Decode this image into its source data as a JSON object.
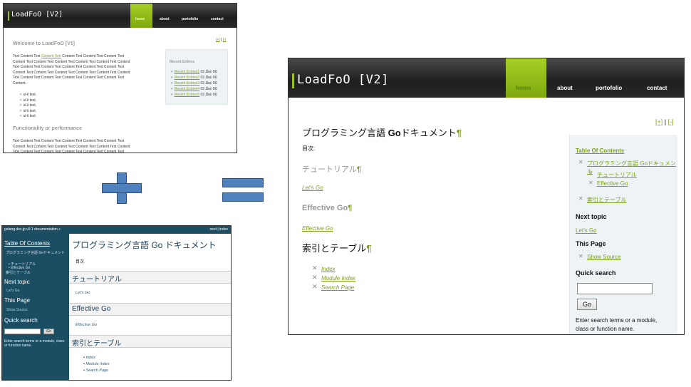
{
  "shotA": {
    "title": "LoadFoO [V2]",
    "nav": [
      "home",
      "about",
      "portofolio",
      "contact"
    ],
    "toggle_plus": "[+]",
    "toggle_sep": "|",
    "toggle_minus": "[-]",
    "welcome": "Welcome to LoadFoO [V1]",
    "para_lines": [
      [
        "Text Content Text ",
        "Content Text",
        " Content Text Content Text Content Text"
      ],
      [
        "Content Text Content Text Content Text Content Text Content Text Content",
        "",
        ""
      ],
      [
        "Text Content Text Content Text Content Text Content Text Content Text",
        "",
        ""
      ],
      [
        "Content Text Content Text Content Text Content Text Content Text Content",
        "",
        ""
      ],
      [
        "Text Content Text Content Text Content Text Content Text Content Text",
        "",
        ""
      ],
      [
        "Content.",
        "",
        ""
      ]
    ],
    "list": [
      "ul-li test.",
      "ul-li test.",
      "ul-li test.",
      "ul-li test.",
      "ul-li test."
    ],
    "recent_title": "Recent Entries",
    "recent": [
      {
        "link": "Recent Entries1",
        "date": "01 Dec 06"
      },
      {
        "link": "Recent Entries2",
        "date": "01 Dec 06"
      },
      {
        "link": "Recent Entries3",
        "date": "01 Dec 06"
      },
      {
        "link": "Recent Entries4",
        "date": "01 Dec 06"
      },
      {
        "link": "Recent Entries5",
        "date": "01 Dec 06"
      }
    ],
    "section2": "Functionality or performance",
    "para2_lines": [
      "Text Content Text Content Text Content Text Content Text Content Text",
      "Content Text Content Text Content Text Content Text Content Text Content",
      "Text Content Text Content Text Content Text Content Text Content Text"
    ]
  },
  "shotB": {
    "topbar_left": "golang.doc.jp v0.1 documentation »",
    "topbar_right": "next | index",
    "toc_title": "Table Of Contents",
    "toc_items": [
      "プログラミング言語 Goドキュメント",
      "チュートリアル",
      "Effective Go",
      "索引とテーブル"
    ],
    "next_topic": "Next topic",
    "next_link": "Let's Go",
    "this_page": "This Page",
    "show_source": "Show Source",
    "quick_search": "Quick search",
    "go_button": "Go",
    "search_help": "Enter search terms or a module, class or function name.",
    "main_title": "プログラミング言語 Go ドキュメント",
    "mokuji": "目次",
    "h_tutorial": "チュートリアル",
    "lets_go": "Let's Go",
    "h_effective": "Effective Go",
    "effective_link": "Effective Go",
    "h_index": "索引とテーブル",
    "index_links": [
      "Index",
      "Module Index",
      "Search Page"
    ]
  },
  "shotC": {
    "title": "LoadFoO [V2]",
    "nav": [
      "home",
      "about",
      "portofolio",
      "contact"
    ],
    "toggle_plus": "[+]",
    "toggle_sep": "|",
    "toggle_minus": "[-]",
    "main_title_jp": "プログラミング言語 ",
    "main_title_go": "Go",
    "main_title_end": "ドキュメント",
    "pilcrow": "¶",
    "mokuji": "目次:",
    "h_tutorial": "チュートリアル",
    "lets_go": "Let's Go",
    "h_effective": "Effective Go",
    "effective_link": "Effective Go",
    "h_index": "索引とテーブル",
    "index_links": [
      "Index",
      "Module Index",
      "Search Page"
    ],
    "sidebar": {
      "toc_title": "Table Of Contents",
      "toc_main": "プログラミング言語 Goドキュメント",
      "toc_sub": [
        "チュートリアル",
        "Effective Go"
      ],
      "toc_index": "索引とテーブル",
      "next_topic": "Next topic",
      "next_link": "Let's Go",
      "this_page": "This Page",
      "show_source": "Show Source",
      "quick_search": "Quick search",
      "go_button": "Go",
      "help_line1": "Enter search terms or a module,",
      "help_line2": "class or function name."
    }
  },
  "colors": {
    "accent_green": "#9ac31c",
    "link_green": "#7da11a",
    "operator_blue": "#4f81bd",
    "sphinx_blue": "#1c4e63"
  }
}
